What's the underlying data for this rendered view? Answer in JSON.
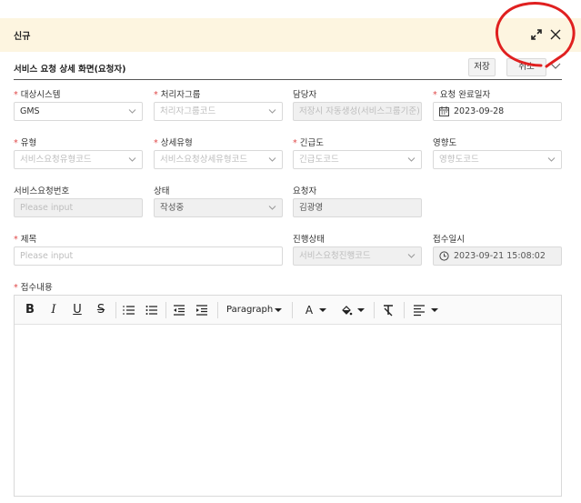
{
  "dialog": {
    "title": "신규",
    "section_title": "서비스 요청 상세 화면(요청자)",
    "save_label": "저장",
    "cancel_label": "취소"
  },
  "fields": {
    "target_system": {
      "label": "대상시스템",
      "required": "*",
      "value": "GMS"
    },
    "handler_group": {
      "label": "처리자그룹",
      "required": "*",
      "placeholder": "처리자그룹코드"
    },
    "assignee": {
      "label": "담당자",
      "value": "저장시 자동생성(서비스그룹기준)"
    },
    "due_date": {
      "label": "요청 완료일자",
      "required": "*",
      "value": "2023-09-28"
    },
    "type": {
      "label": "유형",
      "required": "*",
      "placeholder": "서비스요청유형코드"
    },
    "detail_type": {
      "label": "상세유형",
      "required": "*",
      "placeholder": "서비스요청상세유형코드"
    },
    "urgency": {
      "label": "긴급도",
      "required": "*",
      "placeholder": "긴급도코드"
    },
    "impact": {
      "label": "영향도",
      "placeholder": "영향도코드"
    },
    "request_no": {
      "label": "서비스요청번호",
      "placeholder": "Please input"
    },
    "status": {
      "label": "상태",
      "value": "작성중"
    },
    "requester": {
      "label": "요청자",
      "value": "김광영"
    },
    "subject": {
      "label": "제목",
      "required": "*",
      "placeholder": "Please input"
    },
    "progress_status": {
      "label": "진행상태",
      "placeholder": "서비스요청진행코드"
    },
    "received_at": {
      "label": "접수일시",
      "value": "2023-09-21 15:08:02"
    },
    "content": {
      "label": "접수내용",
      "required": "*"
    }
  },
  "editor": {
    "paragraph_label": "Paragraph",
    "font_color_label": "A",
    "tools": [
      "bold-icon",
      "italic-icon",
      "underline-icon",
      "strikethrough-icon",
      "numbered-list-icon",
      "bulleted-list-icon",
      "outdent-icon",
      "indent-icon",
      "font-color-icon",
      "highlight-icon",
      "clear-format-icon",
      "align-icon"
    ]
  },
  "colors": {
    "header_bg": "#fdf5e0",
    "required": "#e04848",
    "annotation": "#e02020"
  }
}
